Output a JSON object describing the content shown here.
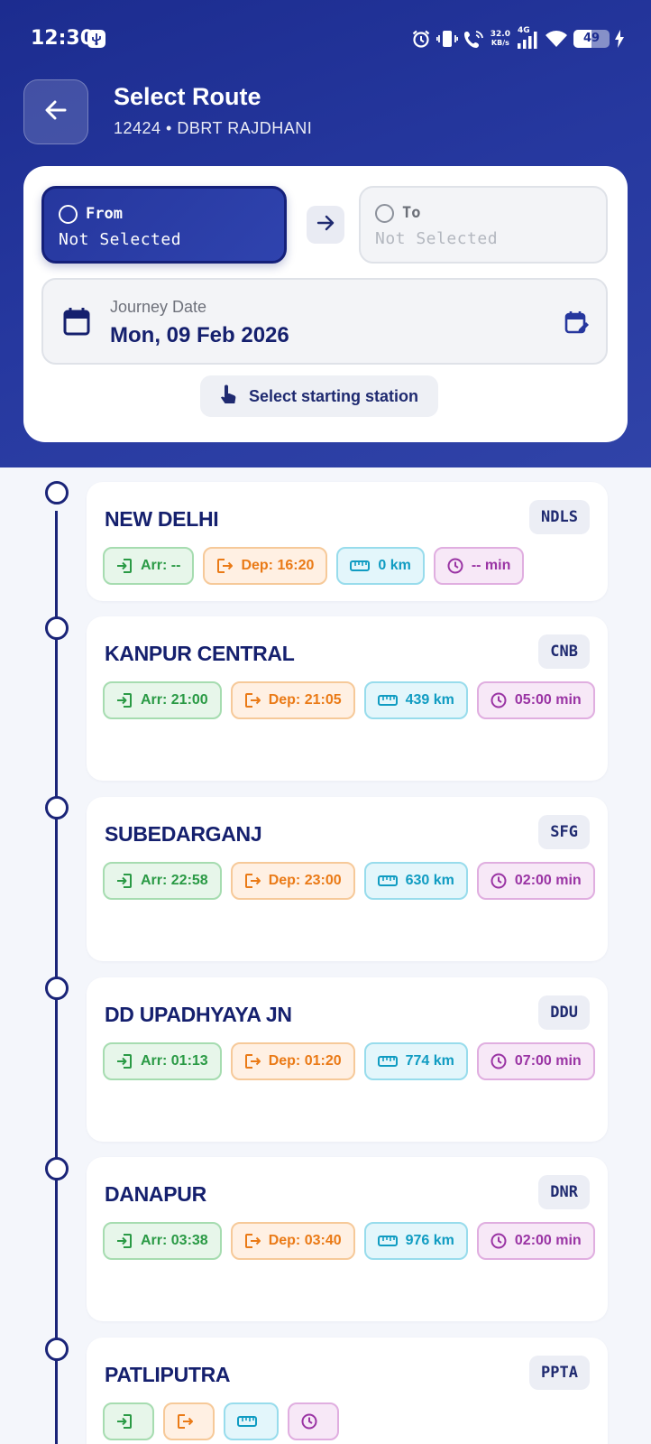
{
  "status_bar": {
    "time": "12:30",
    "network_speed": "32.0",
    "network_speed_unit": "KB/s",
    "network_type": "4G",
    "battery_level": "49",
    "battery_fraction": 0.49
  },
  "header": {
    "title": "Select Route",
    "subtitle": "12424 • DBRT RAJDHANI"
  },
  "route_selector": {
    "from": {
      "label": "From",
      "value": "Not Selected",
      "active": true
    },
    "to": {
      "label": "To",
      "value": "Not Selected",
      "active": false
    }
  },
  "journey": {
    "label": "Journey Date",
    "date": "Mon, 09 Feb 2026"
  },
  "hint": "Select starting station",
  "colors": {
    "header_start": "#1c2c8f",
    "header_end": "#3043a8",
    "primary_text": "#15206e",
    "arrival": "#2a9a45",
    "departure": "#ea7a16",
    "distance": "#109cc2",
    "duration": "#9a34a4"
  },
  "stations": [
    {
      "name": "NEW DELHI",
      "code": "NDLS",
      "arr": "Arr: --",
      "dep": "Dep: 16:20",
      "dist": "0 km",
      "dur": "-- min"
    },
    {
      "name": "KANPUR CENTRAL",
      "code": "CNB",
      "arr": "Arr: 21:00",
      "dep": "Dep: 21:05",
      "dist": "439 km",
      "dur": "05:00 min"
    },
    {
      "name": "SUBEDARGANJ",
      "code": "SFG",
      "arr": "Arr: 22:58",
      "dep": "Dep: 23:00",
      "dist": "630 km",
      "dur": "02:00 min"
    },
    {
      "name": "DD UPADHYAYA JN",
      "code": "DDU",
      "arr": "Arr: 01:13",
      "dep": "Dep: 01:20",
      "dist": "774 km",
      "dur": "07:00 min"
    },
    {
      "name": "DANAPUR",
      "code": "DNR",
      "arr": "Arr: 03:38",
      "dep": "Dep: 03:40",
      "dist": "976 km",
      "dur": "02:00 min"
    },
    {
      "name": "PATLIPUTRA",
      "code": "PPTA",
      "arr": "",
      "dep": "",
      "dist": "",
      "dur": ""
    }
  ]
}
